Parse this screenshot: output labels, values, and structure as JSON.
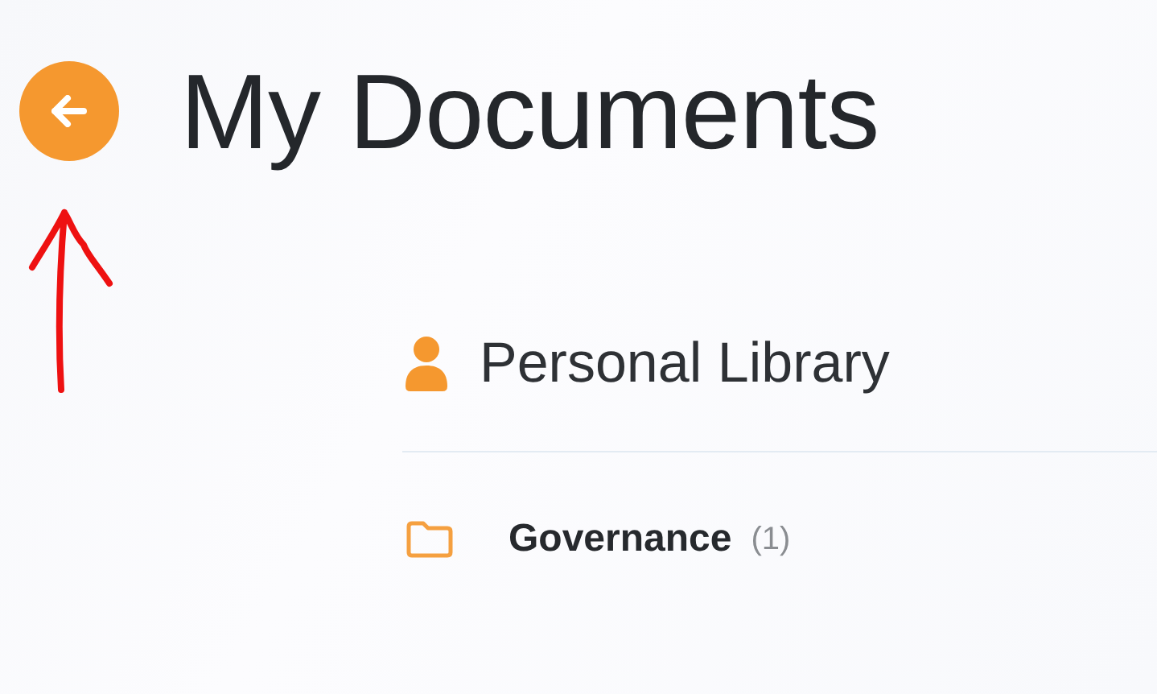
{
  "header": {
    "title": "My Documents"
  },
  "library": {
    "title": "Personal Library",
    "folders": [
      {
        "name": "Governance",
        "count": "(1)"
      }
    ]
  }
}
